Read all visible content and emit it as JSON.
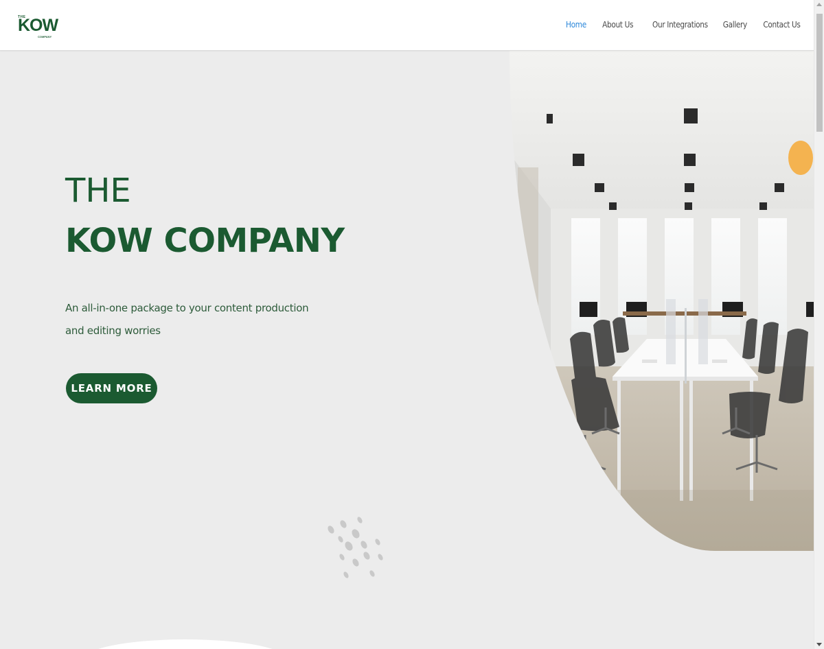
{
  "logo": {
    "the": "THE",
    "kow": "KOW",
    "company": "COMPANY"
  },
  "nav": {
    "items": [
      {
        "label": "Home",
        "active": true
      },
      {
        "label": "About Us"
      },
      {
        "label": "Our Integrations"
      },
      {
        "label": "Gallery"
      },
      {
        "label": "Contact Us"
      }
    ]
  },
  "hero": {
    "title_line1": "THE",
    "title_bold": "KOW",
    "title_rest": " COMPANY",
    "subtitle": "An all-in-one package to your content production and editing worries",
    "cta_label": "LEARN MORE"
  },
  "colors": {
    "brand_green": "#1b5a31",
    "accent_orange": "#f4b350",
    "nav_active": "#2b87da",
    "background": "#ececec"
  }
}
